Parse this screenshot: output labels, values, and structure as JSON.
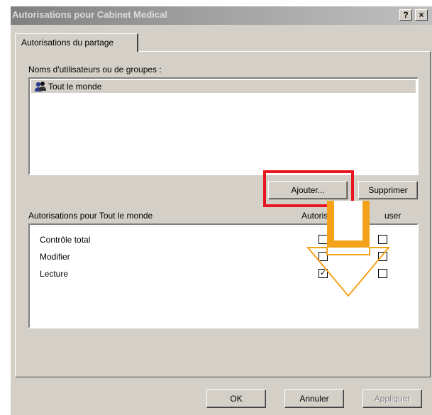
{
  "dialog": {
    "title": "Autorisations pour Cabinet Medical",
    "help_label": "?",
    "close_label": "×"
  },
  "tabs": [
    {
      "label": "Autorisations du partage"
    }
  ],
  "users": {
    "label": "Noms d'utilisateurs ou de groupes :",
    "items": [
      {
        "name": "Tout le monde",
        "icon": "group-icon"
      }
    ]
  },
  "buttons": {
    "add": "Ajouter...",
    "remove": "Supprimer",
    "ok": "OK",
    "cancel": "Annuler",
    "apply": "Appliquer"
  },
  "permissions": {
    "label": "Autorisations pour Tout le monde",
    "col_allow": "Autoris",
    "col_deny": "user",
    "rows": [
      {
        "name": "Contrôle total",
        "allow": false,
        "deny": false
      },
      {
        "name": "Modifier",
        "allow": false,
        "deny": false
      },
      {
        "name": "Lecture",
        "allow": true,
        "deny": false
      }
    ]
  },
  "annotations": {
    "highlight_color": "#e8141f",
    "arrow_color": "#f5a21b"
  }
}
